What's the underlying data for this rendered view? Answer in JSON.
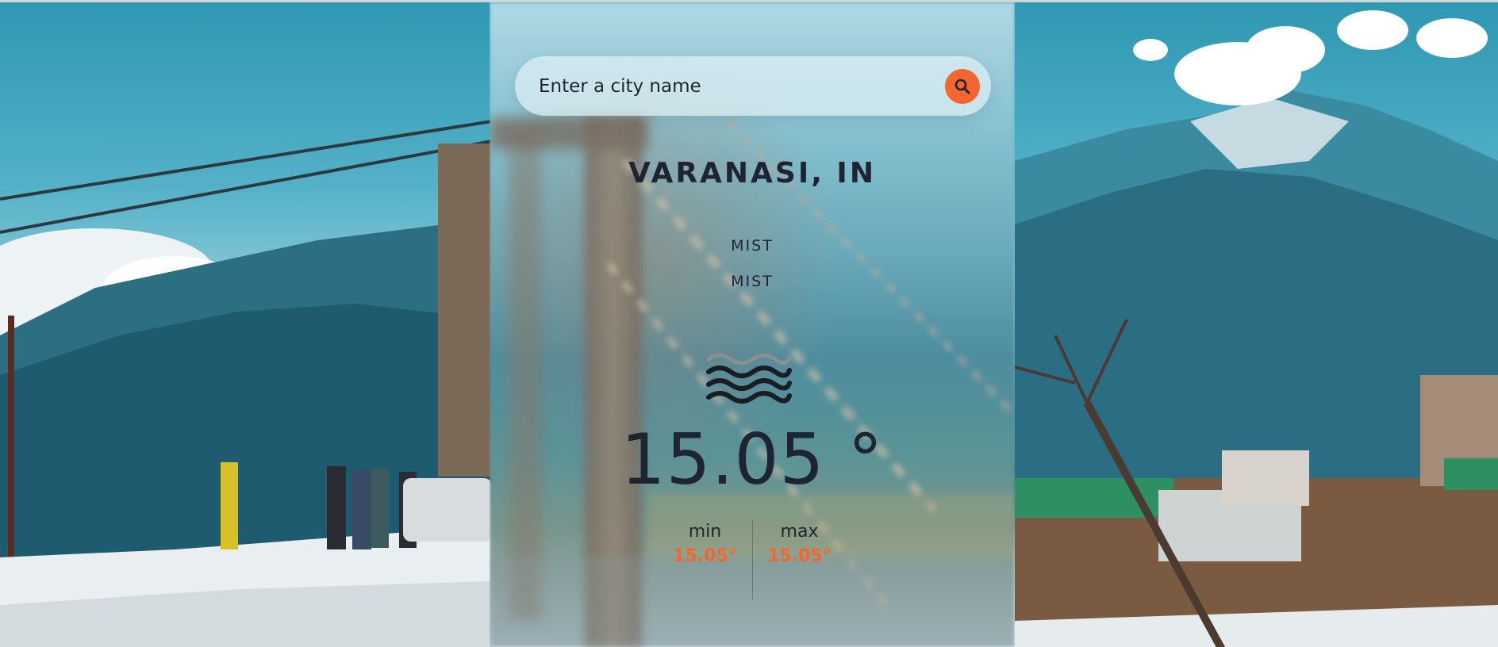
{
  "search": {
    "placeholder": "Enter a city name",
    "button_icon": "search-icon"
  },
  "weather": {
    "city": "VARANASI, IN",
    "condition_main": "MIST",
    "condition_desc": "MIST",
    "icon": "mist-icon",
    "temperature": "15.05 °",
    "min_label": "min",
    "min_value": "15.05°",
    "max_label": "max",
    "max_value": "15.05°"
  },
  "colors": {
    "accent": "#f4662f",
    "text": "#1f2432"
  }
}
